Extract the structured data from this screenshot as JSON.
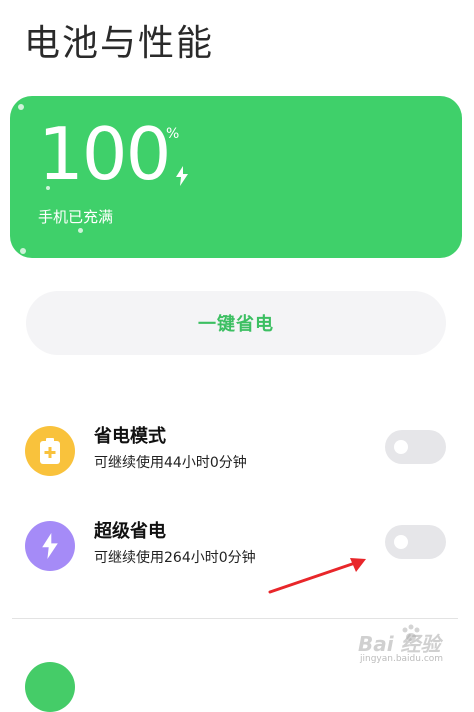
{
  "page": {
    "title": "电池与性能"
  },
  "battery": {
    "level": "100",
    "percent_sign": "%",
    "status": "手机已充满",
    "card_color": "#3fd06a",
    "charging_icon": "lightning-bolt-icon"
  },
  "one_key_saver": {
    "label": "一键省电",
    "text_color": "#3cbf62"
  },
  "settings": [
    {
      "title": "省电模式",
      "subtitle": "可继续使用44小时0分钟",
      "icon": "battery-plus-icon",
      "icon_color": "#f9c23c",
      "enabled": false
    },
    {
      "title": "超级省电",
      "subtitle": "可继续使用264小时0分钟",
      "icon": "lightning-bolt-icon",
      "icon_color": "#a58bf7",
      "enabled": false
    }
  ],
  "annotation": {
    "arrow_color": "#e8262a"
  },
  "watermark": {
    "main": "Bai 经验",
    "sub": "jingyan.baidu.com"
  }
}
